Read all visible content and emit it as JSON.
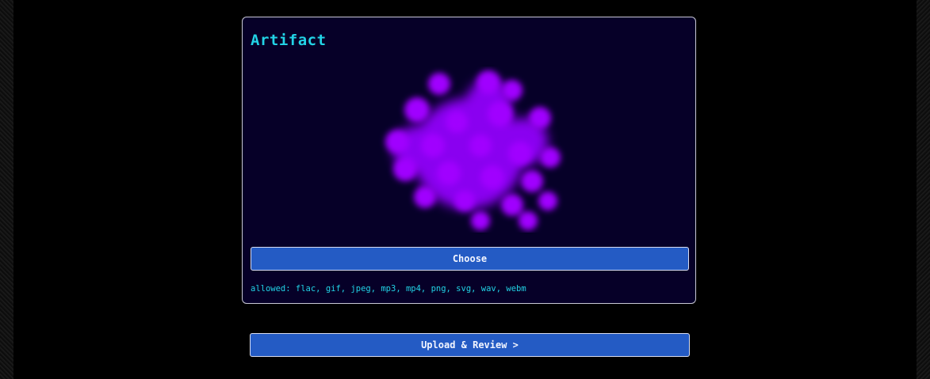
{
  "artifact": {
    "title": "Artifact",
    "preview_icon": "purple-blob-cluster-image",
    "choose_label": "Choose",
    "allowed_text": "allowed: flac, gif, jpeg, mp3, mp4, png, svg, wav, webm"
  },
  "upload": {
    "label": "Upload & Review >"
  },
  "colors": {
    "accent_text": "#22d3e6",
    "button_bg": "#245bc4",
    "card_bg": "#060028",
    "blob": "#9b00ff"
  }
}
